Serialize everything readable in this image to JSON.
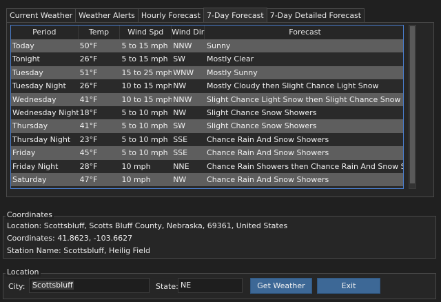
{
  "tabs": [
    {
      "label": "Current Weather",
      "active": false
    },
    {
      "label": "Weather Alerts",
      "active": false
    },
    {
      "label": "Hourly Forecast",
      "active": false
    },
    {
      "label": "7-Day Forecast",
      "active": true
    },
    {
      "label": "7-Day Detailed Forecast",
      "active": false
    }
  ],
  "forecast": {
    "columns": [
      "Period",
      "Temp",
      "Wind Spd",
      "Wind Dir",
      "Forecast"
    ],
    "rows": [
      [
        "Today",
        "50°F",
        "5 to 15 mph",
        "NNW",
        "Sunny"
      ],
      [
        "Tonight",
        "26°F",
        "5 to 15 mph",
        "SW",
        "Mostly Clear"
      ],
      [
        "Tuesday",
        "51°F",
        "15 to 25 mph",
        "WNW",
        "Mostly Sunny"
      ],
      [
        "Tuesday Night",
        "26°F",
        "10 to 15 mph",
        "NW",
        "Mostly Cloudy then Slight Chance Light Snow"
      ],
      [
        "Wednesday",
        "41°F",
        "10 to 15 mph",
        "NNW",
        "Slight Chance Light Snow then Slight Chance Snow Showers"
      ],
      [
        "Wednesday Night",
        "18°F",
        "5 to 10 mph",
        "NW",
        "Slight Chance Snow Showers"
      ],
      [
        "Thursday",
        "41°F",
        "5 to 10 mph",
        "SW",
        "Slight Chance Snow Showers"
      ],
      [
        "Thursday Night",
        "23°F",
        "5 to 10 mph",
        "SSE",
        "Chance Rain And Snow Showers"
      ],
      [
        "Friday",
        "45°F",
        "5 to 10 mph",
        "SSE",
        "Chance Rain And Snow Showers"
      ],
      [
        "Friday Night",
        "28°F",
        "10 mph",
        "NNE",
        "Chance Rain Showers then Chance Rain And Snow Showers"
      ],
      [
        "Saturday",
        "47°F",
        "10 mph",
        "NW",
        "Chance Rain And Snow Showers"
      ]
    ]
  },
  "coordinates": {
    "title": "Coordinates",
    "location_line": "Location: Scottsbluff, Scotts Bluff County, Nebraska, 69361, United States",
    "coords_line": "Coordinates: 41.8623, -103.6627",
    "station_line": "Station Name: Scottsbluff, Heilig Field"
  },
  "location": {
    "title": "Location",
    "city_label": "City:",
    "city_value": "Scottsbluff",
    "state_label": "State:",
    "state_value": "NE",
    "get_weather_label": "Get Weather",
    "exit_label": "Exit"
  },
  "colors": {
    "background": "#202020",
    "row_alt": "#5e5e5e",
    "grid_border": "#4a7fd0",
    "button": "#3d6896"
  }
}
